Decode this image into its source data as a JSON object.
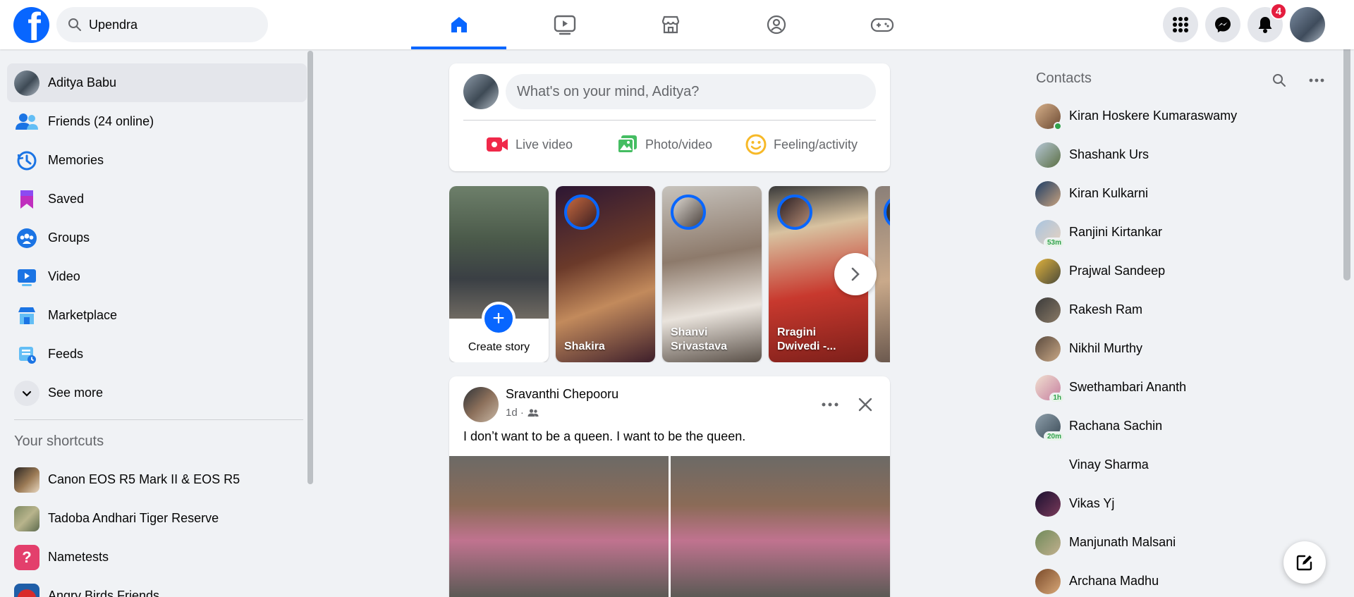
{
  "search": {
    "value": "Upendra",
    "icon": "search-icon"
  },
  "nav": {
    "tabs": [
      {
        "name": "home",
        "icon": "home-icon",
        "active": true
      },
      {
        "name": "video",
        "icon": "video-icon",
        "active": false
      },
      {
        "name": "marketplace",
        "icon": "marketplace-icon",
        "active": false
      },
      {
        "name": "groups",
        "icon": "groups-icon",
        "active": false
      },
      {
        "name": "gaming",
        "icon": "gaming-icon",
        "active": false
      }
    ],
    "notifications_count": "4",
    "accent": "#0866ff"
  },
  "sidebar": {
    "profile_name": "Aditya Babu",
    "items": [
      {
        "label": "Friends (24 online)",
        "icon": "friends-icon"
      },
      {
        "label": "Memories",
        "icon": "memories-icon"
      },
      {
        "label": "Saved",
        "icon": "saved-icon"
      },
      {
        "label": "Groups",
        "icon": "groups-icon"
      },
      {
        "label": "Video",
        "icon": "video-icon"
      },
      {
        "label": "Marketplace",
        "icon": "marketplace-icon"
      },
      {
        "label": "Feeds",
        "icon": "feeds-icon"
      },
      {
        "label": "See more",
        "icon": "chevron-down-icon"
      }
    ],
    "shortcuts_title": "Your shortcuts",
    "shortcuts": [
      {
        "label": "Canon EOS R5 Mark II & EOS R5"
      },
      {
        "label": "Tadoba Andhari Tiger Reserve"
      },
      {
        "label": "Nametests"
      },
      {
        "label": "Angry Birds Friends"
      }
    ]
  },
  "composer": {
    "placeholder": "What's on your mind, Aditya?",
    "actions": [
      {
        "label": "Live video",
        "icon": "live-video-icon",
        "color": "#f02849"
      },
      {
        "label": "Photo/video",
        "icon": "photo-icon",
        "color": "#45bd62"
      },
      {
        "label": "Feeling/activity",
        "icon": "feeling-icon",
        "color": "#f7b928"
      }
    ]
  },
  "stories": {
    "create_label": "Create story",
    "items": [
      {
        "name": "Shakira"
      },
      {
        "name": "Shanvi Srivastava"
      },
      {
        "name": "Rragini Dwivedi -..."
      }
    ]
  },
  "post": {
    "author": "Sravanthi Chepooru",
    "time": "1d ·",
    "text": "I don’t want to be a queen. I want to be the queen."
  },
  "contacts": {
    "title": "Contacts",
    "items": [
      {
        "name": "Kiran Hoskere Kumaraswamy",
        "online": true
      },
      {
        "name": "Shashank Urs"
      },
      {
        "name": "Kiran Kulkarni"
      },
      {
        "name": "Ranjini Kirtankar",
        "ago": "53m"
      },
      {
        "name": "Prajwal Sandeep"
      },
      {
        "name": "Rakesh Ram"
      },
      {
        "name": "Nikhil Murthy"
      },
      {
        "name": "Swethambari Ananth",
        "ago": "1h"
      },
      {
        "name": "Rachana Sachin",
        "ago": "20m"
      },
      {
        "name": "Vinay Sharma"
      },
      {
        "name": "Vikas Yj"
      },
      {
        "name": "Manjunath Malsani"
      },
      {
        "name": "Archana Madhu"
      }
    ]
  }
}
